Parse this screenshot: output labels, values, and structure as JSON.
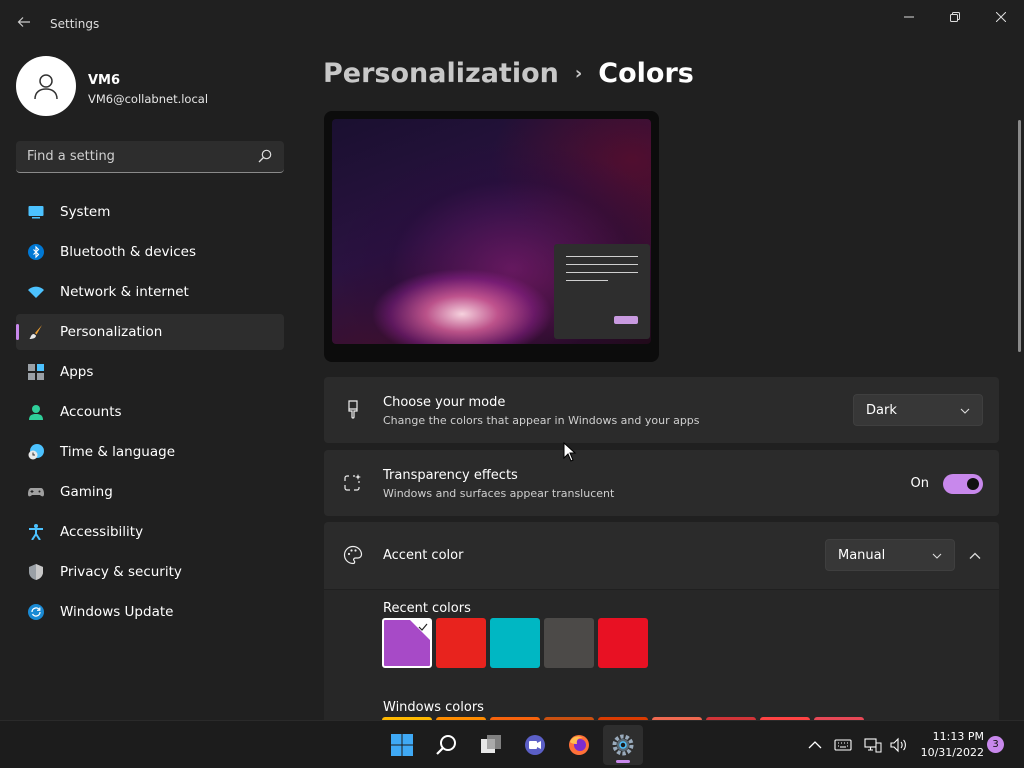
{
  "window": {
    "title": "Settings"
  },
  "profile": {
    "name": "VM6",
    "email": "VM6@collabnet.local"
  },
  "search": {
    "placeholder": "Find a setting"
  },
  "nav": {
    "items": [
      {
        "label": "System",
        "icon": "system-icon"
      },
      {
        "label": "Bluetooth & devices",
        "icon": "bluetooth-icon"
      },
      {
        "label": "Network & internet",
        "icon": "wifi-icon"
      },
      {
        "label": "Personalization",
        "icon": "paintbrush-icon",
        "active": true
      },
      {
        "label": "Apps",
        "icon": "apps-icon"
      },
      {
        "label": "Accounts",
        "icon": "accounts-icon"
      },
      {
        "label": "Time & language",
        "icon": "clock-globe-icon"
      },
      {
        "label": "Gaming",
        "icon": "gamepad-icon"
      },
      {
        "label": "Accessibility",
        "icon": "accessibility-icon"
      },
      {
        "label": "Privacy & security",
        "icon": "shield-icon"
      },
      {
        "label": "Windows Update",
        "icon": "update-icon"
      }
    ]
  },
  "breadcrumb": {
    "parent": "Personalization",
    "separator": "›",
    "current": "Colors"
  },
  "mode": {
    "title": "Choose your mode",
    "description": "Change the colors that appear in Windows and your apps",
    "value": "Dark"
  },
  "transparency": {
    "title": "Transparency effects",
    "description": "Windows and surfaces appear translucent",
    "state": "On"
  },
  "accent": {
    "title": "Accent color",
    "value": "Manual",
    "recent_title": "Recent colors",
    "recent_colors": [
      "#a74ac7",
      "#e8231e",
      "#00b7c3",
      "#4c4a48",
      "#e81123"
    ],
    "windows_title": "Windows colors",
    "windows_colors": [
      "#ffb900",
      "#ff8c00",
      "#f7630c",
      "#ca5010",
      "#da3b01",
      "#ef6950",
      "#d13438",
      "#ff4343",
      "#e74856"
    ]
  },
  "colors": {
    "accent": "#c888ec",
    "background": "#202020",
    "card": "#2b2b2b"
  },
  "taskbar": {
    "apps": [
      "windows-start-icon",
      "search-icon",
      "task-view-icon",
      "chat-icon",
      "firefox-icon",
      "settings-gear-icon"
    ],
    "time": "11:13 PM",
    "date": "10/31/2022",
    "notification_count": "3"
  }
}
